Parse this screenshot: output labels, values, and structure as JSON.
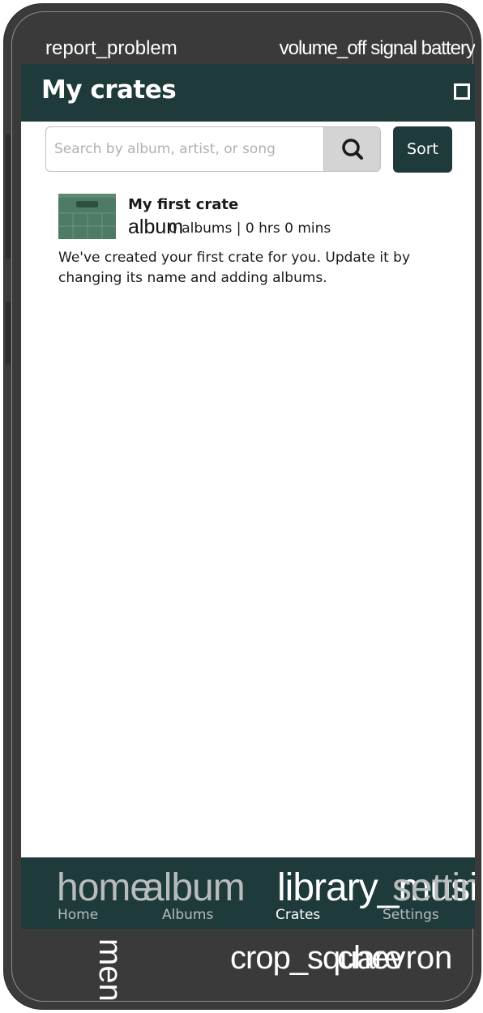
{
  "status_bar": {
    "left_icon": "report_problem",
    "right_icons": "volume_off signal battery"
  },
  "app_bar": {
    "title": "My crates",
    "action_icon": "crop-square-icon"
  },
  "search": {
    "placeholder": "Search by album, artist, or song",
    "value": ""
  },
  "sort_button": {
    "label": "Sort"
  },
  "crates": [
    {
      "name": "My first crate",
      "icon_text": "album",
      "meta": "0 albums  |  0 hrs 0 mins",
      "description": "We've created your first crate for you. Update it by changing its name and adding albums."
    }
  ],
  "bottom_nav": [
    {
      "icon_text": "home",
      "label": "Home",
      "active": false
    },
    {
      "icon_text": "album",
      "label": "Albums",
      "active": false
    },
    {
      "icon_text": "library_music",
      "label": "Crates",
      "active": true
    },
    {
      "icon_text": "settings",
      "label": "Settings",
      "active": false
    }
  ],
  "system_nav": {
    "menu_icon_text": "menu",
    "home_icon_text": "crop_square",
    "back_icon_text": "chevron"
  },
  "colors": {
    "primary_dark": "#1e3a3b",
    "crate_green": "#4f7a65",
    "nav_inactive": "#b8bcbc",
    "nav_active": "#ffffff",
    "device_frame": "#3a3a3a"
  }
}
